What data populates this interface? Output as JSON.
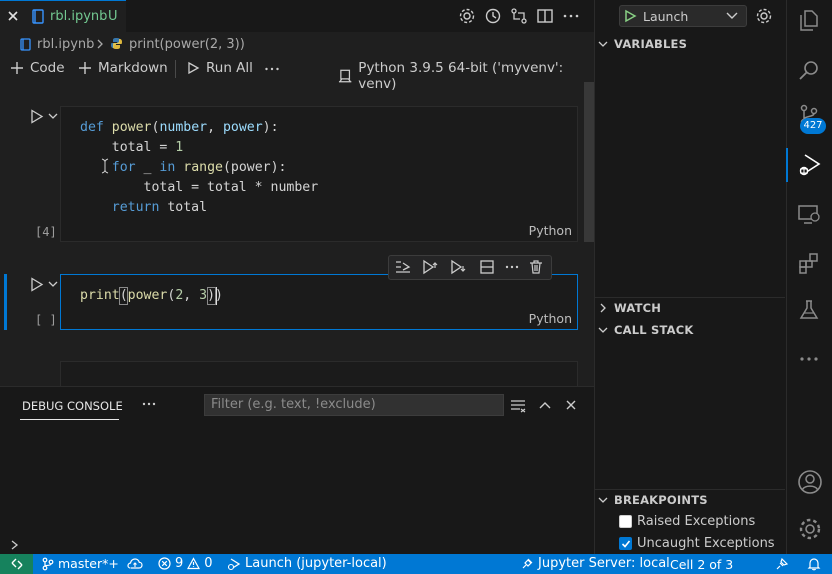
{
  "tab": {
    "filename": "rbl.ipynb",
    "status": "U"
  },
  "breadcrumb": {
    "file": "rbl.ipynb",
    "symbol": "print(power(2, 3))"
  },
  "toolbar": {
    "code": "Code",
    "markdown": "Markdown",
    "run_all": "Run All",
    "kernel": "Python 3.9.5 64-bit ('myvenv': venv)"
  },
  "cells": [
    {
      "exec_count": "[4]",
      "language": "Python",
      "lines": [
        {
          "t": [
            [
              "def",
              "kw"
            ],
            [
              " ",
              ""
            ],
            [
              "power",
              "fn"
            ],
            [
              "(",
              ""
            ],
            [
              "number",
              "pm"
            ],
            [
              ", ",
              ""
            ],
            [
              "power",
              "pm"
            ],
            [
              "):",
              ""
            ]
          ]
        },
        {
          "t": [
            [
              "    total = ",
              ""
            ],
            [
              "1",
              "num"
            ]
          ]
        },
        {
          "t": [
            [
              "    ",
              ""
            ],
            [
              "for",
              "kw"
            ],
            [
              " _ ",
              ""
            ],
            [
              "in",
              "kw"
            ],
            [
              " ",
              ""
            ],
            [
              "range",
              "fn"
            ],
            [
              "(power):",
              ""
            ]
          ]
        },
        {
          "t": [
            [
              "        total = total * number",
              ""
            ]
          ]
        },
        {
          "t": [
            [
              "    ",
              ""
            ],
            [
              "return",
              "kw"
            ],
            [
              " total",
              ""
            ]
          ]
        }
      ]
    },
    {
      "exec_count": "[ ]",
      "language": "Python",
      "lines": [
        {
          "t": [
            [
              "print",
              "fn"
            ],
            [
              "(",
              ""
            ],
            [
              "power",
              "fn"
            ],
            [
              "(",
              ""
            ],
            [
              "2",
              "num"
            ],
            [
              ", ",
              ""
            ],
            [
              "3",
              "num"
            ],
            [
              "))",
              ""
            ]
          ]
        }
      ]
    }
  ],
  "panel": {
    "tab": "DEBUG CONSOLE",
    "filter_placeholder": "Filter (e.g. text, !exclude)"
  },
  "debug": {
    "launch_config": "Launch",
    "sections": {
      "variables": "VARIABLES",
      "watch": "WATCH",
      "call_stack": "CALL STACK",
      "breakpoints": "BREAKPOINTS"
    },
    "breakpoints": [
      {
        "label": "Raised Exceptions",
        "checked": false
      },
      {
        "label": "Uncaught Exceptions",
        "checked": true
      }
    ]
  },
  "activity": {
    "scm_badge": "427"
  },
  "statusbar": {
    "branch": "master*+",
    "errors": "9",
    "warnings": "0",
    "launch": "Launch (jupyter-local)",
    "jupyter": "Jupyter Server: local",
    "cell": "Cell 2 of 3"
  },
  "colors": {
    "accent": "#0078d4",
    "remote": "#16825d",
    "run_green": "#89d185",
    "badge": "#0078d4"
  }
}
